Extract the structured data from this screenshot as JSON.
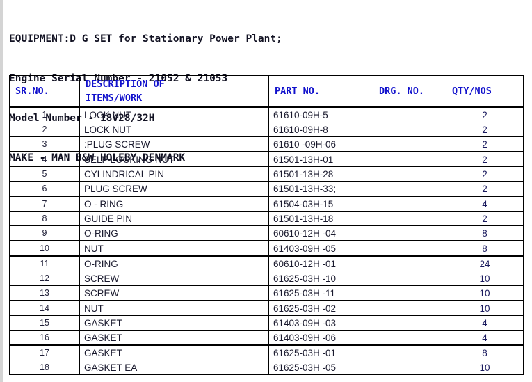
{
  "document": {
    "header_lines": [
      "EQUIPMENT:D G SET for Stationary Power Plant;",
      "Engine Serial Number - 21052 & 21053",
      "Model Number - 18V28/32H",
      "MAKE - MAN B&W HOLEBY,DENMARK"
    ]
  },
  "colors": {
    "header_text": "#111122",
    "table_header_text": "#1111cc",
    "body_text": "#1a1a2e",
    "qty_text": "#1a1a5e",
    "border": "#000000",
    "page_background": "#ffffff",
    "left_margin_strip": "#d4d4d4"
  },
  "table": {
    "columns": [
      {
        "key": "sr",
        "label": "SR.NO."
      },
      {
        "key": "desc",
        "label": "DESCRIPTION OF\nITEMS/WORK"
      },
      {
        "key": "part",
        "label": "PART NO."
      },
      {
        "key": "drg",
        "label": "DRG. NO."
      },
      {
        "key": "qty",
        "label": "QTY/NOS"
      }
    ],
    "rows": [
      {
        "sr": "1",
        "desc": "LOCK NUT",
        "part": "61610-09H-5",
        "drg": "",
        "qty": "2",
        "group_end": false
      },
      {
        "sr": "2",
        "desc": "LOCK NUT",
        "part": "61610-09H-8",
        "drg": "",
        "qty": "2",
        "group_end": false
      },
      {
        "sr": "3",
        "desc": ":PLUG SCREW",
        "part": "61610 -09H-06",
        "drg": "",
        "qty": "2",
        "group_end": true
      },
      {
        "sr": "4",
        "desc": "SELF LOCKING NUT",
        "part": "61501-13H-01",
        "drg": "",
        "qty": "2",
        "group_end": false
      },
      {
        "sr": "5",
        "desc": "CYLINDRICAL PIN",
        "part": "61501-13H-28",
        "drg": "",
        "qty": "2",
        "group_end": false
      },
      {
        "sr": "6",
        "desc": "PLUG SCREW",
        "part": "61501-13H-33;",
        "drg": "",
        "qty": "2",
        "group_end": true
      },
      {
        "sr": "7",
        "desc": "O - RING",
        "part": "61504-03H-15",
        "drg": "",
        "qty": "4",
        "group_end": false
      },
      {
        "sr": "8",
        "desc": "GUIDE PIN",
        "part": "61501-13H-18",
        "drg": "",
        "qty": "2",
        "group_end": false
      },
      {
        "sr": "9",
        "desc": "O-RING",
        "part": "60610-12H -04",
        "drg": "",
        "qty": "8",
        "group_end": true
      },
      {
        "sr": "10",
        "desc": "NUT",
        "part": "61403-09H -05",
        "drg": "",
        "qty": "8",
        "group_end": true
      },
      {
        "sr": "11",
        "desc": "O-RING",
        "part": "60610-12H -01",
        "drg": "",
        "qty": "24",
        "group_end": false
      },
      {
        "sr": "12",
        "desc": "SCREW",
        "part": "61625-03H -10",
        "drg": "",
        "qty": "10",
        "group_end": false
      },
      {
        "sr": "13",
        "desc": "SCREW",
        "part": "61625-03H -11",
        "drg": "",
        "qty": "10",
        "group_end": true
      },
      {
        "sr": "14",
        "desc": "NUT",
        "part": "61625-03H -02",
        "drg": "",
        "qty": "10",
        "group_end": false
      },
      {
        "sr": "15",
        "desc": "GASKET",
        "part": "61403-09H -03",
        "drg": "",
        "qty": "4",
        "group_end": false
      },
      {
        "sr": "16",
        "desc": "GASKET",
        "part": "61403-09H -06",
        "drg": "",
        "qty": "4",
        "group_end": true
      },
      {
        "sr": "17",
        "desc": "GASKET",
        "part": "61625-03H -01",
        "drg": "",
        "qty": "8",
        "group_end": false
      },
      {
        "sr": "18",
        "desc": "GASKET EA",
        "part": "61625-03H -05",
        "drg": "",
        "qty": "10",
        "group_end": false
      }
    ]
  }
}
